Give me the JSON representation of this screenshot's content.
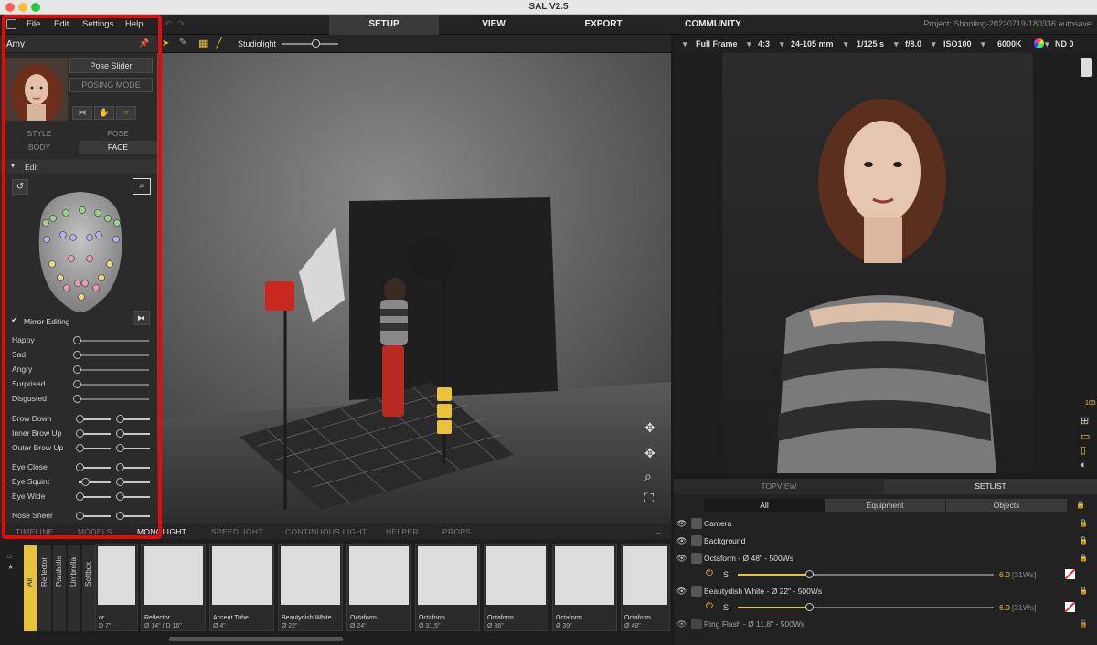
{
  "window": {
    "title": "SAL V2.5"
  },
  "menu": [
    "File",
    "Edit",
    "Settings",
    "Help"
  ],
  "nav_tabs": [
    {
      "label": "SETUP",
      "active": true
    },
    {
      "label": "VIEW",
      "active": false
    },
    {
      "label": "EXPORT",
      "active": false
    },
    {
      "label": "COMMUNITY",
      "active": false
    }
  ],
  "project": "Project: Shooting-20220719-180336.autosave",
  "model_panel": {
    "name": "Amy",
    "pose_slider_label": "Pose Slider",
    "posing_mode_label": "POSING MODE",
    "tabs_row1": [
      "STYLE",
      "POSE"
    ],
    "tabs_row2": [
      "BODY",
      "FACE"
    ],
    "edit_label": "Edit",
    "mirror_label": "Mirror Editing",
    "expressions": [
      {
        "label": "Happy",
        "value": 0
      },
      {
        "label": "Sad",
        "value": 0
      },
      {
        "label": "Angry",
        "value": 0
      },
      {
        "label": "Surprised",
        "value": 0
      },
      {
        "label": "Disgusted",
        "value": 0
      }
    ],
    "face_sliders": [
      {
        "label": "Brow Down",
        "left": 0.5,
        "right": 0.5
      },
      {
        "label": "Inner Brow Up",
        "left": 0.5,
        "right": 0.5
      },
      {
        "label": "Outer Brow Up",
        "left": 0.5,
        "right": 0.5
      },
      {
        "label": "Eye Close",
        "left": 0.5,
        "right": 0.5
      },
      {
        "label": "Eye Squint",
        "left": 0.3,
        "right": 0.5
      },
      {
        "label": "Eye Wide",
        "left": 0.5,
        "right": 0.5
      },
      {
        "label": "Nose Sneer",
        "left": 0.5,
        "right": 0.5
      }
    ]
  },
  "viewport": {
    "light_label": "Studiolight",
    "light_value": 0.6
  },
  "camera_settings": [
    "Full Frame",
    "4:3",
    "24-105 mm",
    "1/125 s",
    "f/8.0",
    "ISO100",
    "6000K",
    "ND 0"
  ],
  "bottom_tabs": [
    "TIMELINE",
    "MODELS",
    "MONOLIGHT",
    "SPEEDLIGHT",
    "CONTINUOUS LIGHT",
    "HELPER",
    "PROPS"
  ],
  "modifier_categories": [
    "All",
    "Reflector",
    "Parabolic",
    "Umbrella",
    "Softbox"
  ],
  "modifiers": [
    {
      "name": "or",
      "size": "D 7\""
    },
    {
      "name": "Reflector",
      "size": "Ø 14\" / D 16\""
    },
    {
      "name": "Accent Tube",
      "size": "Ø 4\""
    },
    {
      "name": "Beautydish White",
      "size": "Ø 22\""
    },
    {
      "name": "Octaform",
      "size": "Ø 24\""
    },
    {
      "name": "Octaform",
      "size": "Ø 31,5\""
    },
    {
      "name": "Octaform",
      "size": "Ø 36\""
    },
    {
      "name": "Octaform",
      "size": "Ø 39\""
    },
    {
      "name": "Octaform",
      "size": "Ø 48\""
    }
  ],
  "view_tabs": [
    "TOPVIEW",
    "SETLIST"
  ],
  "setlist_filters": [
    "All",
    "Equipment",
    "Objects"
  ],
  "setlist": [
    {
      "name": "Camera"
    },
    {
      "name": "Background"
    },
    {
      "name": "Octaform - Ø 48\" - 500Ws",
      "power": "6.0",
      "ws": "[31Ws]",
      "slider": 0.28
    },
    {
      "name": "Beautydish White - Ø 22\" - 500Ws",
      "power": "6.0",
      "ws": "[31Ws]",
      "slider": 0.28
    },
    {
      "name": "Ring Flash - Ø 11,8\" - 500Ws"
    }
  ],
  "colors": {
    "accent": "#e8c23a",
    "highlight": "#e10d0d"
  }
}
